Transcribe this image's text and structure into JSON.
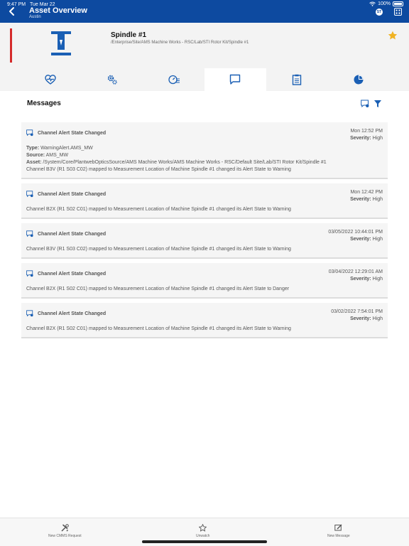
{
  "status": {
    "time": "9:47 PM",
    "date": "Tue Mar 22",
    "battery": "100%"
  },
  "header": {
    "title": "Asset Overview",
    "subtitle": "Austin",
    "avatar_initials": "ST"
  },
  "asset": {
    "name": "Spindle #1",
    "path": "/Enterprise/Site/AMS Machine Works - RSC/Lab/STI Rotor Kit/Spindle #1",
    "status_color": "#d52b2b",
    "favorite_color": "#f0b323"
  },
  "tabs": [
    {
      "icon": "heart-pulse-icon"
    },
    {
      "icon": "gears-icon"
    },
    {
      "icon": "gauge-list-icon"
    },
    {
      "icon": "messages-icon",
      "active": true
    },
    {
      "icon": "clipboard-icon"
    },
    {
      "icon": "pie-chart-icon"
    }
  ],
  "messages": {
    "title": "Messages",
    "items": [
      {
        "title": "Channel Alert State Changed",
        "time": "Mon 12:52 PM",
        "severity_label": "Severity:",
        "severity": "High",
        "type_label": "Type:",
        "type": "WarningAlert.AMS_MW",
        "source_label": "Source:",
        "source": "AMS_MW",
        "asset_label": "Asset:",
        "asset": "/System/Core/PlantwebOpticsSource/AMS Machine Works/AMS Machine Works - RSC/Default Site/Lab/STI Rotor Kit/Spindle #1",
        "text": "Channel B3V (R1 S03 C02) mapped to Measurement Location of Machine Spindle #1 changed its Alert State to Warning"
      },
      {
        "title": "Channel Alert State Changed",
        "time": "Mon 12:42 PM",
        "severity_label": "Severity:",
        "severity": "High",
        "text": "Channel B2X (R1 S02 C01) mapped to Measurement Location of Machine Spindle #1 changed its Alert State to Warning"
      },
      {
        "title": "Channel Alert State Changed",
        "time": "03/05/2022 10:44:01 PM",
        "severity_label": "Severity:",
        "severity": "High",
        "text": "Channel B3V (R1 S03 C02) mapped to Measurement Location of Machine Spindle #1 changed its Alert State to Warning"
      },
      {
        "title": "Channel Alert State Changed",
        "time": "03/04/2022 12:29:01 AM",
        "severity_label": "Severity:",
        "severity": "High",
        "text": "Channel B2X (R1 S02 C01) mapped to Measurement Location of Machine Spindle #1 changed its Alert State to Danger"
      },
      {
        "title": "Channel Alert State Changed",
        "time": "03/02/2022 7:54:01 PM",
        "severity_label": "Severity:",
        "severity": "High",
        "text": "Channel B2X (R1 S02 C01) mapped to Measurement Location of Machine Spindle #1 changed its Alert State to Warning"
      }
    ]
  },
  "bottom": {
    "cmms_label": "New CMMS Request",
    "unwatch_label": "Unwatch",
    "new_message_label": "New Message"
  },
  "colors": {
    "header_blue": "#0d4aa0",
    "icon_blue": "#1a5fb4"
  }
}
